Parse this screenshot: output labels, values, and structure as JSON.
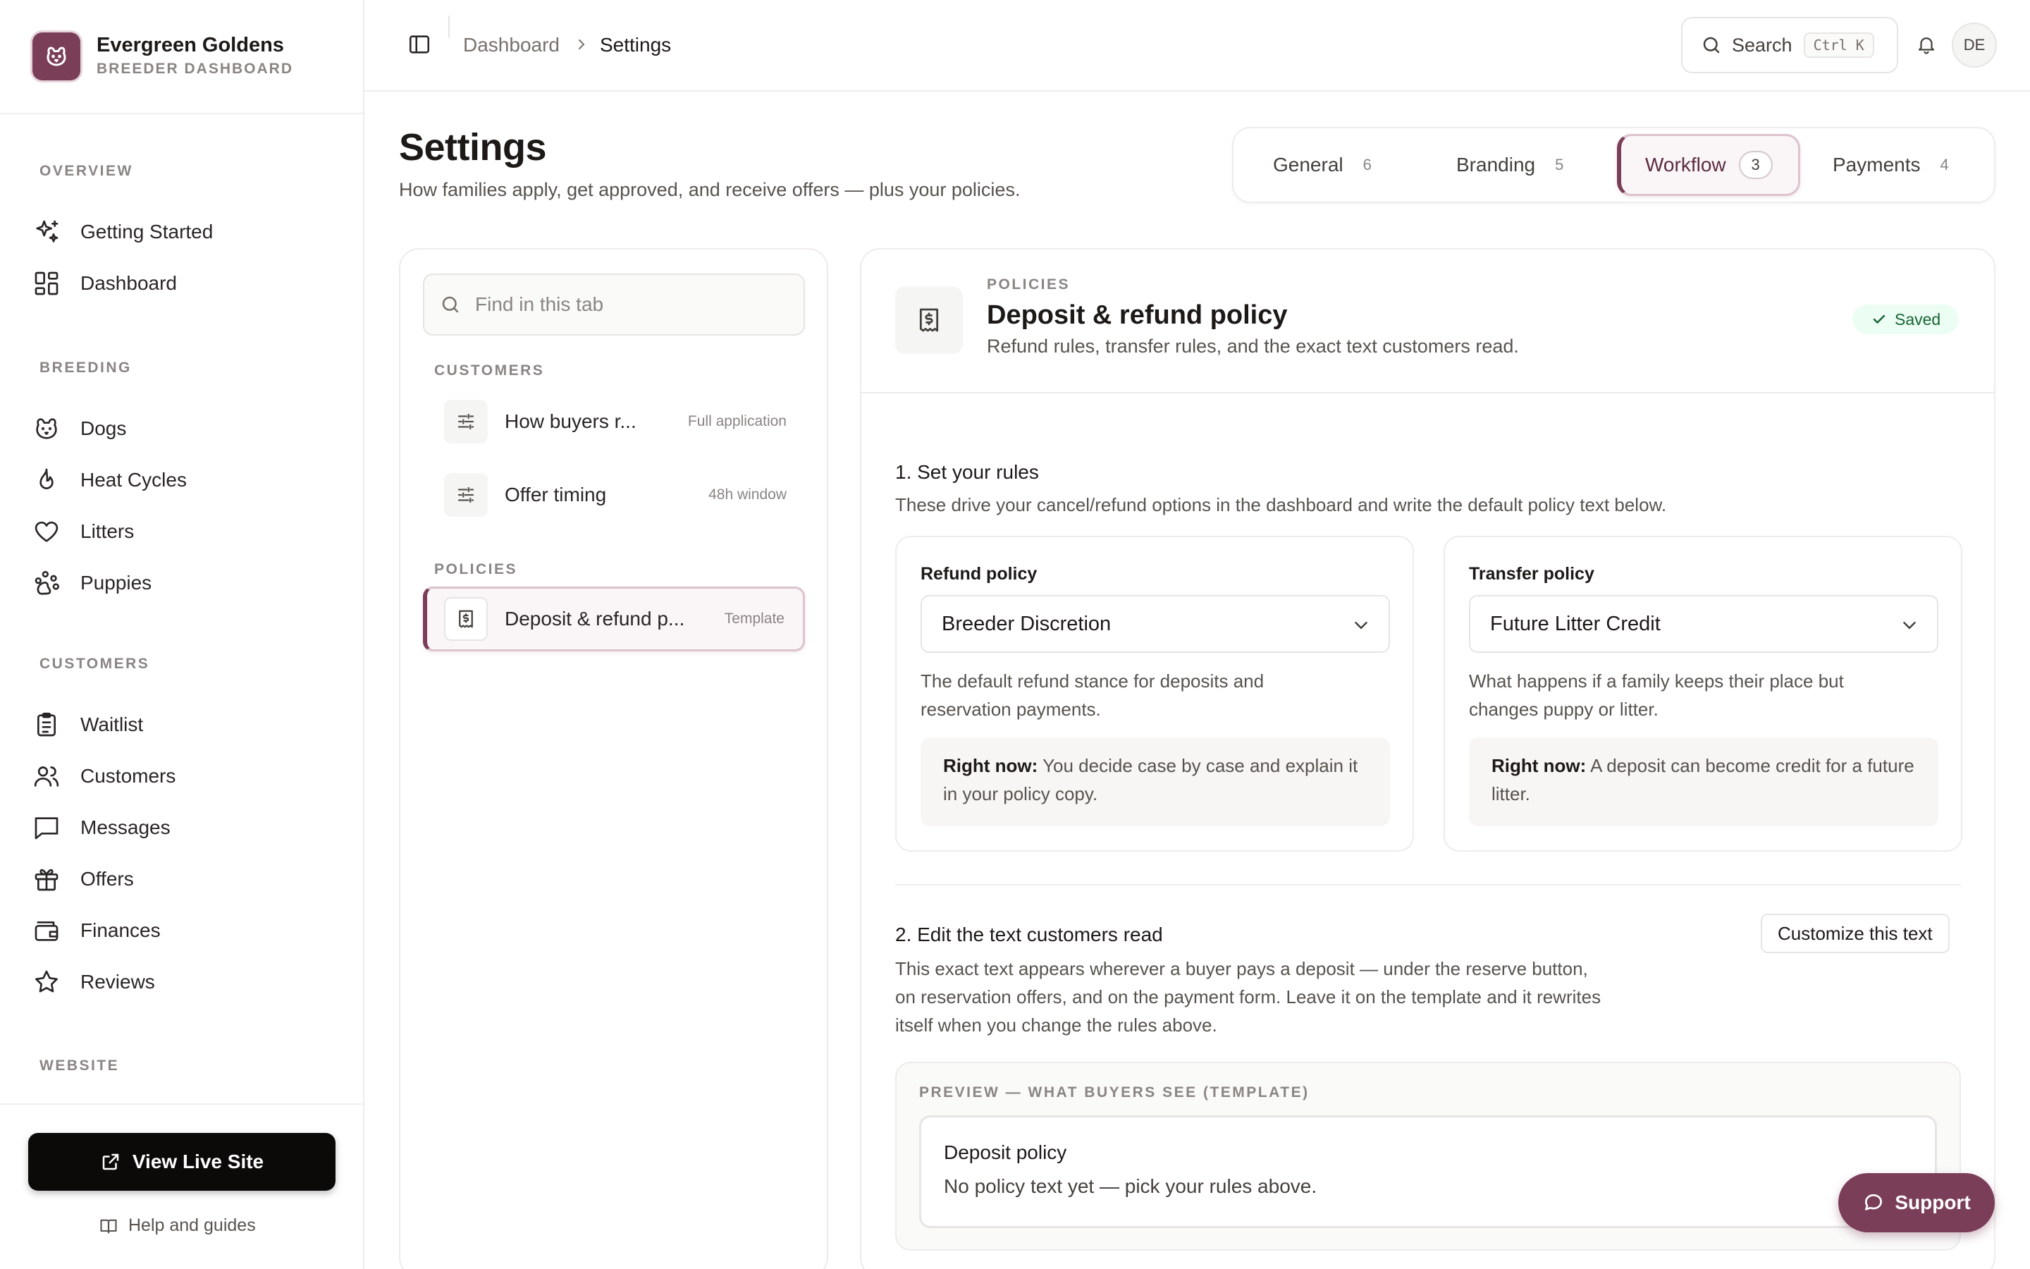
{
  "brand": {
    "name": "Evergreen Goldens",
    "subtitle": "BREEDER DASHBOARD",
    "logo_icon": "paw-face-icon",
    "accent": "#7a3e59"
  },
  "sidebar": {
    "sections": [
      {
        "title": "OVERVIEW",
        "items": [
          {
            "label": "Getting Started",
            "icon": "sparkles-icon"
          },
          {
            "label": "Dashboard",
            "icon": "grid-icon"
          }
        ]
      },
      {
        "title": "BREEDING",
        "items": [
          {
            "label": "Dogs",
            "icon": "dog-icon"
          },
          {
            "label": "Heat Cycles",
            "icon": "flame-icon"
          },
          {
            "label": "Litters",
            "icon": "heart-icon"
          },
          {
            "label": "Puppies",
            "icon": "paw-icon"
          }
        ]
      },
      {
        "title": "CUSTOMERS",
        "items": [
          {
            "label": "Waitlist",
            "icon": "clipboard-icon"
          },
          {
            "label": "Customers",
            "icon": "users-icon"
          },
          {
            "label": "Messages",
            "icon": "message-icon"
          },
          {
            "label": "Offers",
            "icon": "gift-icon"
          },
          {
            "label": "Finances",
            "icon": "wallet-icon"
          },
          {
            "label": "Reviews",
            "icon": "star-icon"
          }
        ]
      },
      {
        "title": "WEBSITE",
        "items": []
      }
    ],
    "live_site_label": "View Live Site",
    "help_label": "Help and guides"
  },
  "topbar": {
    "breadcrumb": [
      "Dashboard",
      "Settings"
    ],
    "search_label": "Search",
    "search_shortcut": "Ctrl K",
    "avatar_initials": "DE"
  },
  "page": {
    "title": "Settings",
    "subtitle": "How families apply, get approved, and receive offers — plus your policies."
  },
  "tabs": [
    {
      "label": "General",
      "count": "6",
      "active": false
    },
    {
      "label": "Branding",
      "count": "5",
      "active": false
    },
    {
      "label": "Workflow",
      "count": "3",
      "active": true
    },
    {
      "label": "Payments",
      "count": "4",
      "active": false
    }
  ],
  "list": {
    "search_placeholder": "Find in this tab",
    "sections": [
      {
        "title": "CUSTOMERS",
        "items": [
          {
            "label": "How buyers r...",
            "meta": "Full application",
            "icon": "sliders-icon"
          },
          {
            "label": "Offer timing",
            "meta": "48h window",
            "icon": "sliders-icon"
          }
        ]
      },
      {
        "title": "POLICIES",
        "items": [
          {
            "label": "Deposit & refund p...",
            "meta": "Template",
            "icon": "receipt-icon",
            "active": true
          }
        ]
      }
    ]
  },
  "detail": {
    "eyebrow": "POLICIES",
    "title": "Deposit & refund policy",
    "subtitle": "Refund rules, transfer rules, and the exact text customers read.",
    "status": "Saved",
    "step1": {
      "title": "1. Set your rules",
      "desc": "These drive your cancel/refund options in the dashboard and write the default policy text below."
    },
    "refund": {
      "label": "Refund policy",
      "value": "Breeder Discretion",
      "help": "The default refund stance for deposits and reservation payments.",
      "now_label": "Right now:",
      "now_text": "You decide case by case and explain it in your policy copy."
    },
    "transfer": {
      "label": "Transfer policy",
      "value": "Future Litter Credit",
      "help": "What happens if a family keeps their place but changes puppy or litter.",
      "now_label": "Right now:",
      "now_text": "A deposit can become credit for a future litter."
    },
    "step2": {
      "title": "2. Edit the text customers read",
      "desc": "This exact text appears wherever a buyer pays a deposit — under the reserve button, on reservation offers, and on the payment form. Leave it on the template and it rewrites itself when you change the rules above.",
      "customize_label": "Customize this text"
    },
    "preview": {
      "label": "PREVIEW — WHAT BUYERS SEE (TEMPLATE)",
      "title": "Deposit policy",
      "text": "No policy text yet — pick your rules above."
    }
  },
  "support_label": "Support"
}
